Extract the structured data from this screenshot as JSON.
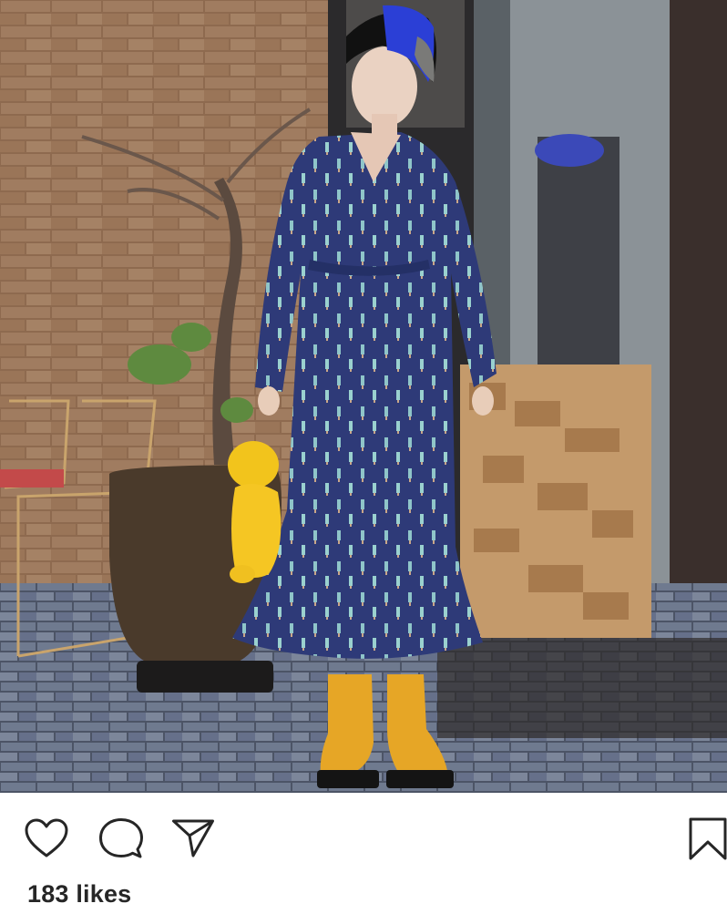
{
  "post": {
    "likes_text": "183 likes"
  },
  "actions": [
    {
      "name": "like",
      "icon": "heart-icon"
    },
    {
      "name": "comment",
      "icon": "comment-icon"
    },
    {
      "name": "share",
      "icon": "send-icon"
    },
    {
      "name": "save",
      "icon": "bookmark-icon"
    }
  ],
  "colors": {
    "text": "#262626",
    "icon_stroke": "#262626",
    "background": "#ffffff"
  }
}
